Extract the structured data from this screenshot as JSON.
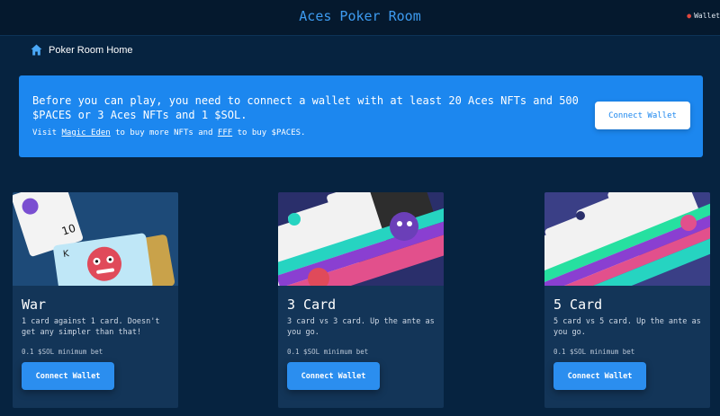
{
  "header": {
    "title": "Aces Poker Room",
    "wallet_label": "Wallet"
  },
  "breadcrumb": {
    "icon": "home-icon",
    "label": "Poker Room Home"
  },
  "banner": {
    "message": "Before you can play, you need to connect a wallet with at least 20 Aces NFTs and 500 $PACES or 3 Aces NFTs and 1 $SOL.",
    "sub_prefix": "Visit ",
    "link1": "Magic Eden",
    "sub_middle": " to buy more NFTs and ",
    "link2": "FFF",
    "sub_suffix": " to buy $PACES.",
    "button": "Connect Wallet"
  },
  "games": [
    {
      "title": "War",
      "description": "1 card against 1 card. Doesn't get any simpler than that!",
      "min_bet": "0.1 $SOL minimum bet",
      "button": "Connect Wallet"
    },
    {
      "title": "3 Card",
      "description": "3 card vs 3 card. Up the ante as you go.",
      "min_bet": "0.1 $SOL minimum bet",
      "button": "Connect Wallet"
    },
    {
      "title": "5 Card",
      "description": "5 card vs 5 card. Up the ante as you go.",
      "min_bet": "0.1 $SOL minimum bet",
      "button": "Connect Wallet"
    }
  ],
  "colors": {
    "background": "#062340",
    "accent": "#1c87ef",
    "card": "#133558",
    "title": "#3d9bf0"
  }
}
